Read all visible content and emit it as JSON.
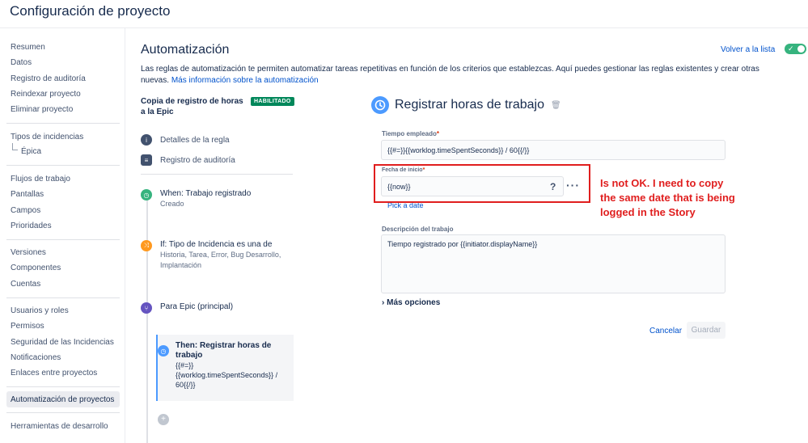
{
  "page_title": "Configuración de proyecto",
  "sidebar": {
    "items": [
      {
        "label": "Resumen"
      },
      {
        "label": "Datos"
      },
      {
        "label": "Registro de auditoría"
      },
      {
        "label": "Reindexar proyecto"
      },
      {
        "label": "Eliminar proyecto"
      },
      {
        "label": "Tipos de incidencias"
      },
      {
        "label": "Épica"
      },
      {
        "label": "Flujos de trabajo"
      },
      {
        "label": "Pantallas"
      },
      {
        "label": "Campos"
      },
      {
        "label": "Prioridades"
      },
      {
        "label": "Versiones"
      },
      {
        "label": "Componentes"
      },
      {
        "label": "Cuentas"
      },
      {
        "label": "Usuarios y roles"
      },
      {
        "label": "Permisos"
      },
      {
        "label": "Seguridad de las Incidencias"
      },
      {
        "label": "Notificaciones"
      },
      {
        "label": "Enlaces entre proyectos"
      },
      {
        "label": "Automatización de proyectos"
      },
      {
        "label": "Herramientas de desarrollo"
      }
    ]
  },
  "main": {
    "title": "Automatización",
    "back_link": "Volver a la lista",
    "description": "Las reglas de automatización te permiten automatizar tareas repetitivas en función de los criterios que establezcas. Aquí puedes gestionar las reglas existentes y crear otras nuevas.",
    "description_link": "Más información sobre la automatización"
  },
  "rule": {
    "name": "Copia de registro de horas a la Epic",
    "status_badge": "HABILITADO",
    "links": {
      "details": "Detalles de la regla",
      "audit": "Registro de auditoría"
    },
    "steps": {
      "when": {
        "title": "When: Trabajo registrado",
        "sub": "Creado"
      },
      "if": {
        "title": "If: Tipo de Incidencia es una de",
        "sub": "Historia, Tarea, Error, Bug Desarrollo, Implantación"
      },
      "branch": {
        "title": "Para Epic (principal)"
      },
      "then": {
        "title": "Then: Registrar horas de trabajo",
        "sub": "{{#=}}{{worklog.timeSpentSeconds}} / 60{{/}}"
      }
    }
  },
  "form": {
    "title": "Registrar horas de trabajo",
    "time_spent": {
      "label": "Tiempo empleado",
      "value": "{{#=}}{{worklog.timeSpentSeconds}} / 60{{/}}"
    },
    "start_date": {
      "label": "Fecha de inicio",
      "value": "{{now}}",
      "help": "?",
      "more": "···",
      "pick_link": "Pick a date"
    },
    "work_desc": {
      "label": "Descripción del trabajo",
      "value": "Tiempo registrado por {{initiator.displayName}}"
    },
    "more_options": "Más opciones",
    "cancel": "Cancelar",
    "save": "Guardar",
    "required_mark": "*"
  },
  "annotation": {
    "text": "Is not OK. I need to copy the same date that is being logged in the Story"
  },
  "colors": {
    "accent": "#0052cc",
    "enabled": "#00875a",
    "annotation": "#e01e1e"
  }
}
